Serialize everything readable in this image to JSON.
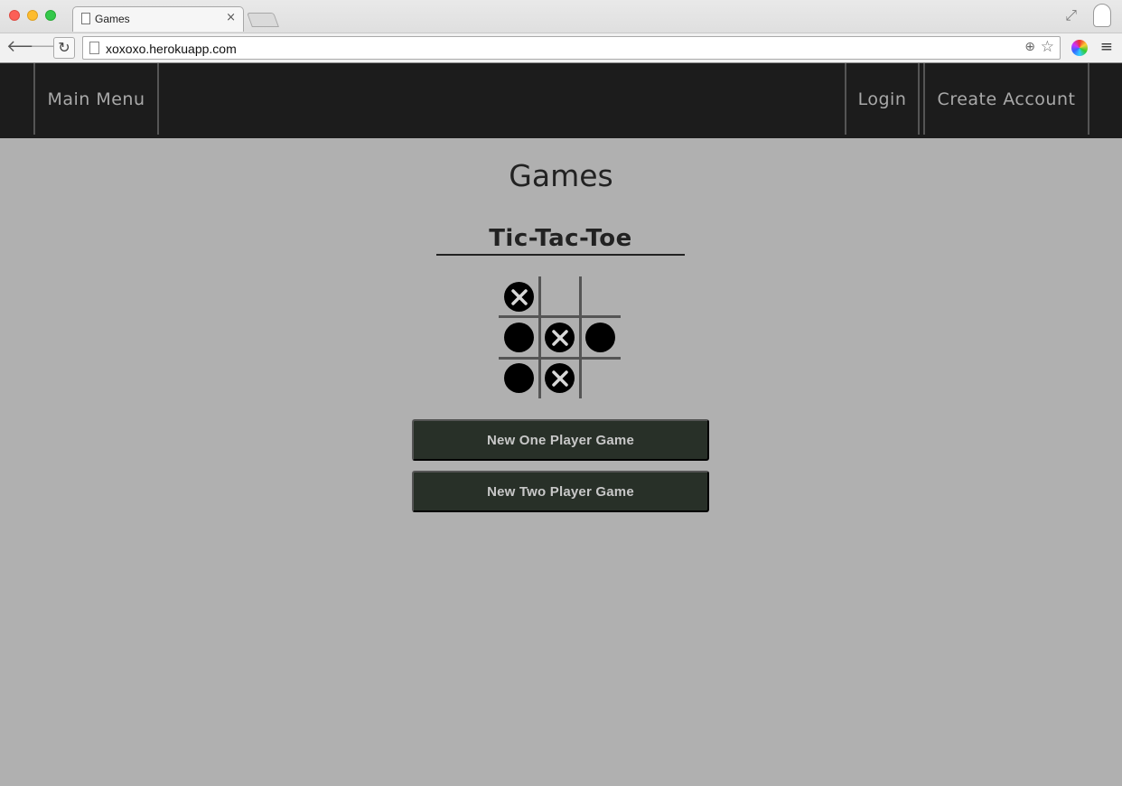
{
  "browser": {
    "tab_title": "Games",
    "tab_close": "×",
    "url": "xoxoxo.herokuapp.com",
    "back_icon": "🡐",
    "forward_icon": "🡒",
    "reload_icon": "↻",
    "menu_icon": "≡",
    "star_icon": "☆",
    "zoom_icon": "⊕",
    "fullscreen_icon": "⤢"
  },
  "nav": {
    "main_menu": "Main Menu",
    "login": "Login",
    "create_account": "Create Account"
  },
  "page": {
    "title": "Games",
    "game_title": "Tic-Tac-Toe"
  },
  "board": {
    "cells": [
      "X",
      "",
      "",
      "O",
      "X",
      "O",
      "O",
      "X",
      ""
    ]
  },
  "buttons": {
    "one_player": "New One Player Game",
    "two_player": "New Two Player Game"
  },
  "colors": {
    "page_bg": "#b0b0b0",
    "nav_bg": "#1c1c1c",
    "nav_text": "#a9a9a9",
    "button_bg": "#283028",
    "button_text": "#c8c8c8",
    "mark": "#000000"
  }
}
